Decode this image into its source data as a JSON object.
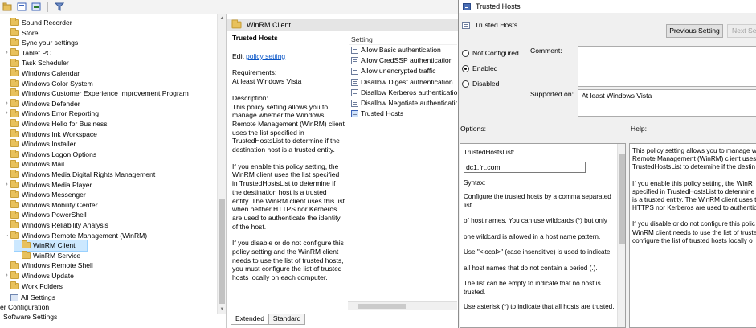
{
  "tree": {
    "items": [
      {
        "label": "Sound Recorder",
        "expand": ""
      },
      {
        "label": "Store",
        "expand": ""
      },
      {
        "label": "Sync your settings",
        "expand": ""
      },
      {
        "label": "Tablet PC",
        "expand": ">"
      },
      {
        "label": "Task Scheduler",
        "expand": ""
      },
      {
        "label": "Windows Calendar",
        "expand": ""
      },
      {
        "label": "Windows Color System",
        "expand": ""
      },
      {
        "label": "Windows Customer Experience Improvement Program",
        "expand": ""
      },
      {
        "label": "Windows Defender",
        "expand": ">"
      },
      {
        "label": "Windows Error Reporting",
        "expand": ">"
      },
      {
        "label": "Windows Hello for Business",
        "expand": ""
      },
      {
        "label": "Windows Ink Workspace",
        "expand": ""
      },
      {
        "label": "Windows Installer",
        "expand": ""
      },
      {
        "label": "Windows Logon Options",
        "expand": ""
      },
      {
        "label": "Windows Mail",
        "expand": ""
      },
      {
        "label": "Windows Media Digital Rights Management",
        "expand": ""
      },
      {
        "label": "Windows Media Player",
        "expand": ">"
      },
      {
        "label": "Windows Messenger",
        "expand": ""
      },
      {
        "label": "Windows Mobility Center",
        "expand": ""
      },
      {
        "label": "Windows PowerShell",
        "expand": ""
      },
      {
        "label": "Windows Reliability Analysis",
        "expand": ""
      },
      {
        "label": "Windows Remote Management (WinRM)",
        "expand": "v"
      },
      {
        "label": "WinRM Client",
        "expand": "",
        "child": true,
        "selected": true
      },
      {
        "label": "WinRM Service",
        "expand": "",
        "child": true
      },
      {
        "label": "Windows Remote Shell",
        "expand": ""
      },
      {
        "label": "Windows Update",
        "expand": ">"
      },
      {
        "label": "Work Folders",
        "expand": ""
      }
    ],
    "all_settings": "All Settings",
    "user_config": "er Configuration",
    "software_settings": "Software Settings"
  },
  "middle": {
    "header": "WinRM Client",
    "title": "Trusted Hosts",
    "edit_prefix": "Edit ",
    "edit_link": "policy setting",
    "requirements_label": "Requirements:",
    "requirements_value": "At least Windows Vista",
    "description_label": "Description:",
    "description_paragraphs": [
      "This policy setting allows you to manage whether the Windows Remote Management (WinRM) client uses the list specified in TrustedHostsList to determine if the destination host is a trusted entity.",
      "If you enable this policy setting, the WinRM client uses the list specified in TrustedHostsList to determine if the destination host is a trusted entity. The WinRM client uses this list when neither HTTPS nor Kerberos are used to authenticate the identity of the host.",
      "If you disable or do not configure this policy setting and the WinRM client needs to use the list of trusted hosts, you must configure the list of trusted hosts locally on each computer."
    ],
    "settings_header": "Setting",
    "settings": [
      "Allow Basic authentication",
      "Allow CredSSP authentication",
      "Allow unencrypted traffic",
      "Disallow Digest authentication",
      "Disallow Kerberos authentication",
      "Disallow Negotiate authentication",
      "Trusted Hosts"
    ],
    "tabs": [
      "Extended",
      "Standard"
    ]
  },
  "dialog": {
    "window_title": "Trusted Hosts",
    "heading": "Trusted Hosts",
    "prev_button": "Previous Setting",
    "next_button": "Next Se",
    "radio_not_configured": "Not Configured",
    "radio_enabled": "Enabled",
    "radio_disabled": "Disabled",
    "comment_label": "Comment:",
    "supported_label": "Supported on:",
    "supported_value": "At least Windows Vista",
    "options_label": "Options:",
    "help_label": "Help:",
    "options": {
      "list_label": "TrustedHostsList:",
      "list_value": "dc1.frt.com",
      "syntax_label": "Syntax:",
      "lines": [
        "Configure the trusted hosts by a comma separated",
        "list",
        "of host names. You can use wildcards (*) but only",
        "one wildcard is allowed in a host name pattern.",
        "Use \"<local>\" (case insensitive) is used to indicate",
        "all host names that do not contain a period (.).",
        "The list can be empty to indicate that no host is",
        "trusted.",
        "Use asterisk (*)  to indicate that all hosts are trusted."
      ]
    },
    "help_paragraphs": [
      [
        "This policy setting allows you to manage w",
        "Remote Management (WinRM) client uses",
        "TrustedHostsList to determine if the destin"
      ],
      [
        "If you enable this policy setting, the WinR",
        "specified in TrustedHostsList to determine",
        "is a trusted entity. The WinRM client uses t",
        "HTTPS nor Kerberos are used to authentica"
      ],
      [
        "If you disable or do not configure this polic",
        "WinRM client needs to use the list of truste",
        "configure the list of trusted hosts locally o"
      ]
    ]
  }
}
